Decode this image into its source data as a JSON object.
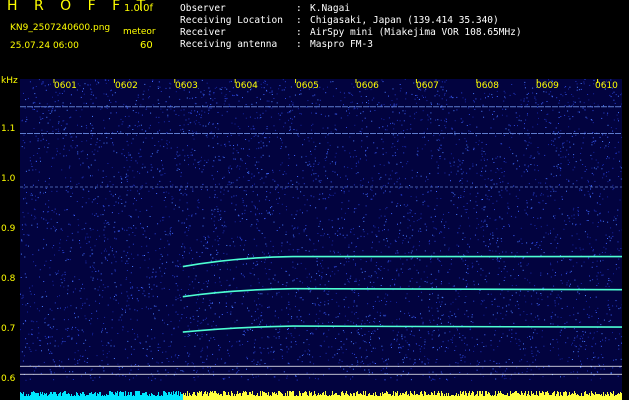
{
  "header": {
    "app_title": "H R O F F T",
    "version": "1.0.0f",
    "filename": "KN9_2507240600.png",
    "datetime": "25.07.24 06:00",
    "meteor_label": "meteor",
    "meteor_count": "60",
    "info": [
      {
        "label": "Observer",
        "value": "K.Nagai"
      },
      {
        "label": "Receiving Location",
        "value": "Chigasaki, Japan (139.414 35.340)"
      },
      {
        "label": "Receiver",
        "value": "AirSpy mini (Miakejima VOR 108.65MHz)"
      },
      {
        "label": "Receiving antenna",
        "value": "Maspro FM-3"
      }
    ],
    "separator": ":"
  },
  "axis": {
    "y_unit": "kHz",
    "y_ticks": [
      "1.1",
      "1.0",
      "0.9",
      "0.8",
      "0.7",
      "0.6"
    ],
    "x_ticks": [
      "0601",
      "0602",
      "0603",
      "0604",
      "0605",
      "0606",
      "0607",
      "0608",
      "0609",
      "0610"
    ]
  },
  "spectrogram": {
    "y_range_khz": [
      0.55,
      1.15
    ],
    "carriers_khz": [
      1.1,
      1.05,
      0.95
    ],
    "traces_khz": [
      0.82,
      0.76,
      0.69
    ],
    "trace_start_time": "0603",
    "baseline_khz": [
      0.615,
      0.6
    ],
    "colors": {
      "background": "#02033f",
      "trace": "#4dffd2",
      "carrier": "#7ea6ff",
      "axis_label": "#ffff00",
      "bottom_bar_cyan": "#00e6ff",
      "bottom_bar_yellow": "#ffff40"
    }
  }
}
